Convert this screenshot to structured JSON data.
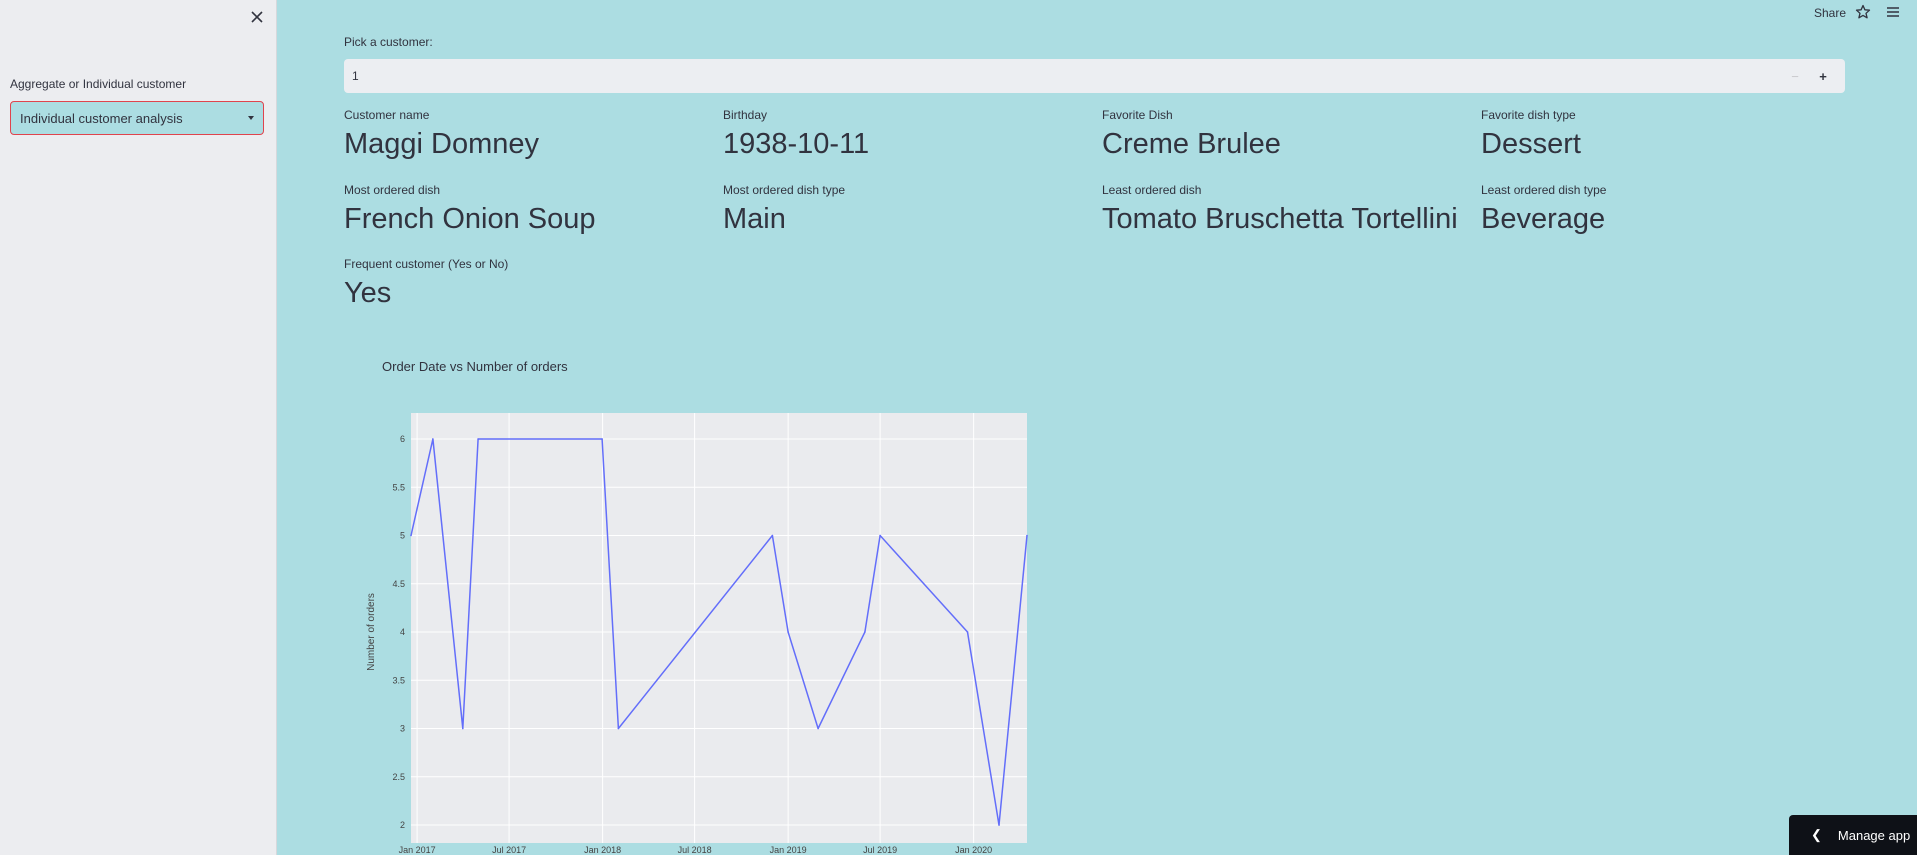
{
  "sidebar": {
    "close_icon": "close-icon",
    "select_label": "Aggregate or Individual customer",
    "select_value": "Individual customer analysis"
  },
  "topbar": {
    "share_label": "Share",
    "star_icon": "star-icon",
    "menu_icon": "hamburger-menu-icon"
  },
  "customer_picker": {
    "label": "Pick a customer:",
    "value": "1",
    "minus": "−",
    "plus": "+"
  },
  "metrics": [
    {
      "label": "Customer name",
      "value": "Maggi Domney"
    },
    {
      "label": "Birthday",
      "value": "1938-10-11"
    },
    {
      "label": "Favorite Dish",
      "value": "Creme Brulee"
    },
    {
      "label": "Favorite dish type",
      "value": "Dessert"
    },
    {
      "label": "Most ordered dish",
      "value": "French Onion Soup"
    },
    {
      "label": "Most ordered dish type",
      "value": "Main"
    },
    {
      "label": "Least ordered dish",
      "value": "Tomato Bruschetta Tortellini"
    },
    {
      "label": "Least ordered dish type",
      "value": "Beverage"
    },
    {
      "label": "Frequent customer (Yes or No)",
      "value": "Yes"
    }
  ],
  "chart_data": {
    "type": "line",
    "title": "Order Date vs Number of orders",
    "xlabel": "",
    "ylabel": "Number of orders",
    "x": [
      "2016-12-20",
      "2017-02-01",
      "2017-04-01",
      "2017-05-01",
      "2017-12-31",
      "2018-02-01",
      "2018-12-01",
      "2019-01-01",
      "2019-03-01",
      "2019-06-01",
      "2019-07-01",
      "2019-12-20",
      "2020-02-20",
      "2020-04-15"
    ],
    "y": [
      5,
      6,
      3,
      6,
      6,
      3,
      5,
      4,
      3,
      4,
      5,
      4,
      2,
      5
    ],
    "ylim": [
      2,
      6
    ],
    "yticks": [
      "2",
      "2.5",
      "3",
      "3.5",
      "4",
      "4.5",
      "5",
      "5.5",
      "6"
    ],
    "xticks": [
      "Jan 2017",
      "Jul 2017",
      "Jan 2018",
      "Jul 2018",
      "Jan 2019",
      "Jul 2019",
      "Jan 2020"
    ],
    "xtick_dates": [
      "2017-01-01",
      "2017-07-01",
      "2018-01-01",
      "2018-07-01",
      "2019-01-01",
      "2019-07-01",
      "2020-01-01"
    ],
    "xlim": [
      "2016-12-20",
      "2020-04-15"
    ],
    "grid": true,
    "line_color": "#636efa",
    "plot_bg": "#eaebee"
  },
  "manage_app": {
    "label": "Manage app",
    "chevron_icon": "chevron-left-icon"
  }
}
